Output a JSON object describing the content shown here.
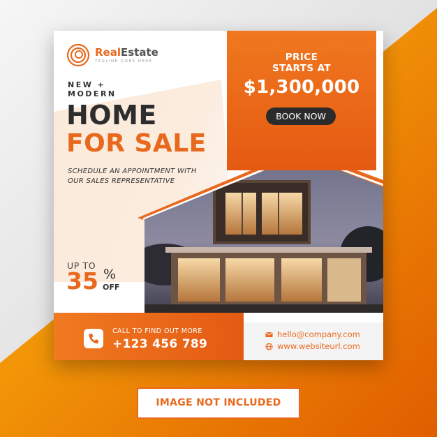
{
  "brand": {
    "name_accent": "Real",
    "name_rest": "Estate",
    "tagline": "TAGLINE GOES HERE"
  },
  "kicker": [
    "NEW +",
    "MODERN"
  ],
  "headline": {
    "line1": "HOME",
    "line2": "FOR SALE"
  },
  "schedule_text": [
    "SCHEDULE AN APPOINTMENT WITH",
    "OUR SALES REPRESENTATIVE"
  ],
  "price": {
    "label": [
      "PRICE",
      "STARTS AT"
    ],
    "value": "$1,300,000",
    "cta": "BOOK NOW"
  },
  "discount": {
    "prefix": "UP TO",
    "value": "35",
    "percent": "%",
    "suffix": "OFF"
  },
  "call": {
    "label": "CALL TO FIND OUT MORE",
    "number": "+123 456 789"
  },
  "contact": {
    "email": "hello@company.com",
    "website": "www.websiteurl.com"
  },
  "disclaimer": "IMAGE NOT INCLUDED",
  "colors": {
    "accent": "#e8691d",
    "dark": "#2d2d2d",
    "background_orange": "#ff9a00"
  },
  "icons": [
    "logo-rings-icon",
    "phone-icon",
    "email-icon",
    "globe-icon"
  ]
}
